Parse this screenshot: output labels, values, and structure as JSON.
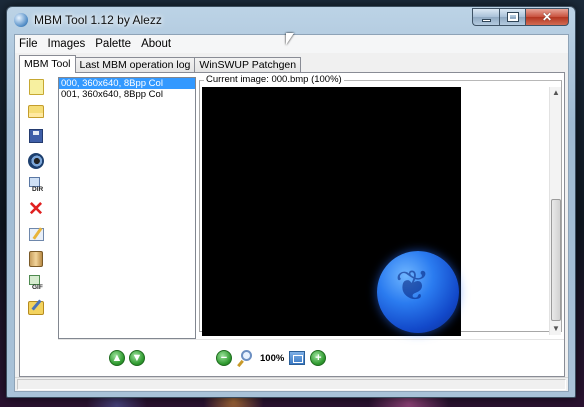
{
  "window": {
    "title": "MBM Tool 1.12 by Alezz"
  },
  "menu": {
    "items": [
      "File",
      "Images",
      "Palette",
      "About"
    ]
  },
  "tabs": [
    {
      "label": "MBM Tool",
      "active": true
    },
    {
      "label": "Last MBM operation log",
      "active": false
    },
    {
      "label": "WinSWUP Patchgen",
      "active": false
    }
  ],
  "toolbar": {
    "icons": [
      "new-icon",
      "open-icon",
      "save-icon",
      "audio-icon",
      "export-dir-icon",
      "delete-icon",
      "edit-icon",
      "tool-icon",
      "export-gif-icon",
      "open-edit-icon"
    ],
    "dir_label": "DIR",
    "gif_label": "GIF"
  },
  "image_list": {
    "items": [
      {
        "label": "000, 360x640, 8Bpp Col",
        "selected": true
      },
      {
        "label": "001, 360x640, 8Bpp Col",
        "selected": false
      }
    ]
  },
  "preview": {
    "caption": "Current image: 000.bmp (100%)"
  },
  "zoom": {
    "label": "100%"
  },
  "icons": {
    "move_up": "arrow-up-icon",
    "move_down": "arrow-down-icon",
    "zoom_out": "minus-icon",
    "zoom": "magnifier-icon",
    "fit": "fit-window-icon",
    "zoom_in": "plus-icon"
  },
  "colors": {
    "selection": "#3399ff",
    "canvas_bg": "#000000",
    "orb": "#2b7cf0",
    "accent_green": "#2f9a2f",
    "close_button": "#c8503c"
  }
}
